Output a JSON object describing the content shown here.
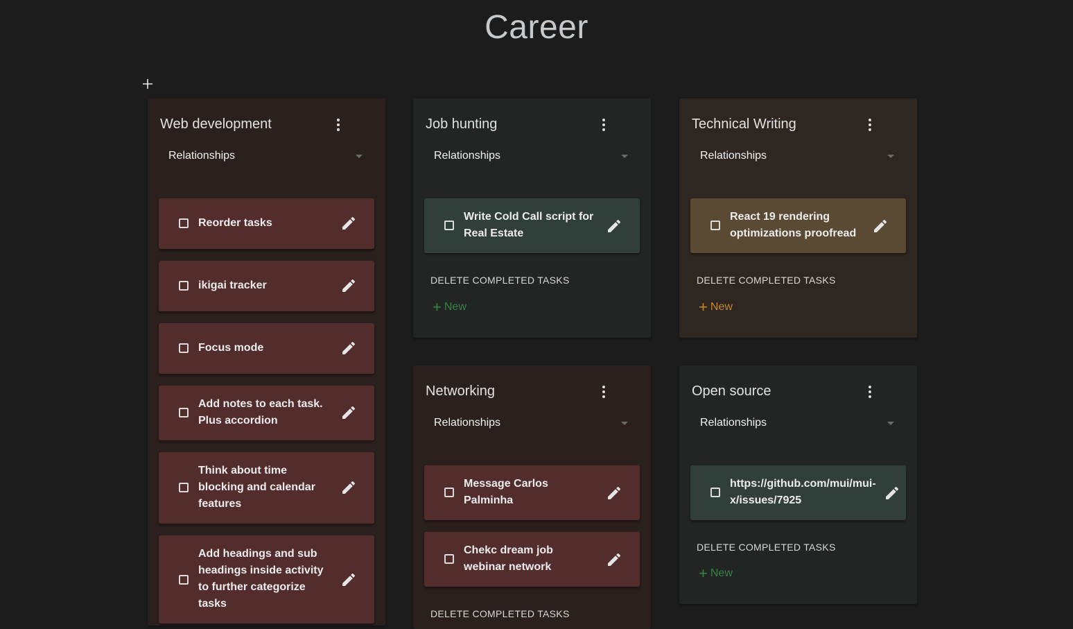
{
  "page": {
    "title": "Career"
  },
  "colors": {
    "background": "#1c1c1c",
    "red_panel": "#2a201e",
    "red_task": "#522d2b",
    "teal_panel": "#212523",
    "teal_task": "#313f3a",
    "amber_panel": "#2e2620",
    "amber_task": "#5b4a33",
    "new_green": "#3f7f46",
    "new_amber": "#c48832"
  },
  "icons": {
    "add_list": "plus-icon",
    "menu": "more-vert-icon",
    "edit": "pencil-icon",
    "checkbox": "checkbox-blank-icon"
  },
  "lists": {
    "web": {
      "title": "Web development",
      "relationship": "Relationships",
      "tasks": [
        "Reorder tasks",
        "ikigai tracker",
        "Focus mode",
        "Add notes to each task. Plus accordion",
        "Think about time blocking and calendar features",
        "Add headings and sub headings inside activity to further categorize tasks"
      ]
    },
    "job": {
      "title": "Job hunting",
      "relationship": "Relationships",
      "tasks": [
        "Write Cold Call script for Real Estate"
      ],
      "delete_label": "DELETE COMPLETED TASKS",
      "new_label": "New"
    },
    "writing": {
      "title": "Technical Writing",
      "relationship": "Relationships",
      "tasks": [
        "React 19 rendering optimizations proofread"
      ],
      "delete_label": "DELETE COMPLETED TASKS",
      "new_label": "New"
    },
    "networking": {
      "title": "Networking",
      "relationship": "Relationships",
      "tasks": [
        "Message Carlos Palminha",
        "Chekc dream job webinar network"
      ],
      "delete_label": "DELETE COMPLETED TASKS"
    },
    "opensource": {
      "title": "Open source",
      "relationship": "Relationships",
      "tasks": [
        "https://github.com/mui/mui-x/issues/7925"
      ],
      "delete_label": "DELETE COMPLETED TASKS",
      "new_label": "New"
    }
  }
}
